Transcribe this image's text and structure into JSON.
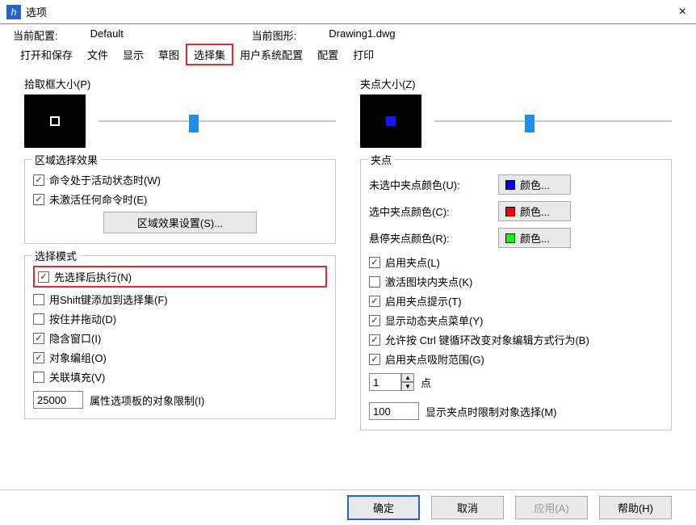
{
  "window": {
    "title": "选项",
    "close": "×"
  },
  "info": {
    "cfgLabel": "当前配置:",
    "cfgValue": "Default",
    "dwgLabel": "当前图形:",
    "dwgValue": "Drawing1.dwg"
  },
  "tabs": [
    "打开和保存",
    "文件",
    "显示",
    "草图",
    "选择集",
    "用户系统配置",
    "配置",
    "打印"
  ],
  "left": {
    "pickTitle": "拾取框大小(P)",
    "regionTitle": "区域选择效果",
    "chkActive": "命令处于活动状态时(W)",
    "chkInactive": "未激活任何命令时(E)",
    "regionBtn": "区域效果设置(S)...",
    "selModeTitle": "选择模式",
    "chkPreExec": "先选择后执行(N)",
    "chkShift": "用Shift键添加到选择集(F)",
    "chkDrag": "按住并拖动(D)",
    "chkImplied": "隐含窗口(I)",
    "chkObjGrp": "对象编组(O)",
    "chkHatch": "关联填充(V)",
    "limitVal": "25000",
    "limitLbl": "属性选项板的对象限制(I)"
  },
  "right": {
    "gripTitle": "夹点大小(Z)",
    "gripsTitle": "夹点",
    "unselLbl": "未选中夹点颜色(U):",
    "selLbl": "选中夹点颜色(C):",
    "hoverLbl": "悬停夹点颜色(R):",
    "colorBtn": "颜色...",
    "chkEnableGrip": "启用夹点(L)",
    "chkBlockGrip": "激活图块内夹点(K)",
    "chkGripTip": "启用夹点提示(T)",
    "chkDynMenu": "显示动态夹点菜单(Y)",
    "chkCtrl": "允许按 Ctrl 键循环改变对象编辑方式行为(B)",
    "chkSnap": "启用夹点吸附范围(G)",
    "dotVal": "1",
    "dotLbl": "点",
    "limVal": "100",
    "limLbl": "显示夹点时限制对象选择(M)"
  },
  "footer": {
    "ok": "确定",
    "cancel": "取消",
    "apply": "应用(A)",
    "help": "帮助(H)"
  },
  "colors": {
    "unsel": "#0000ff",
    "sel": "#ff0000",
    "hover": "#00ff00"
  }
}
